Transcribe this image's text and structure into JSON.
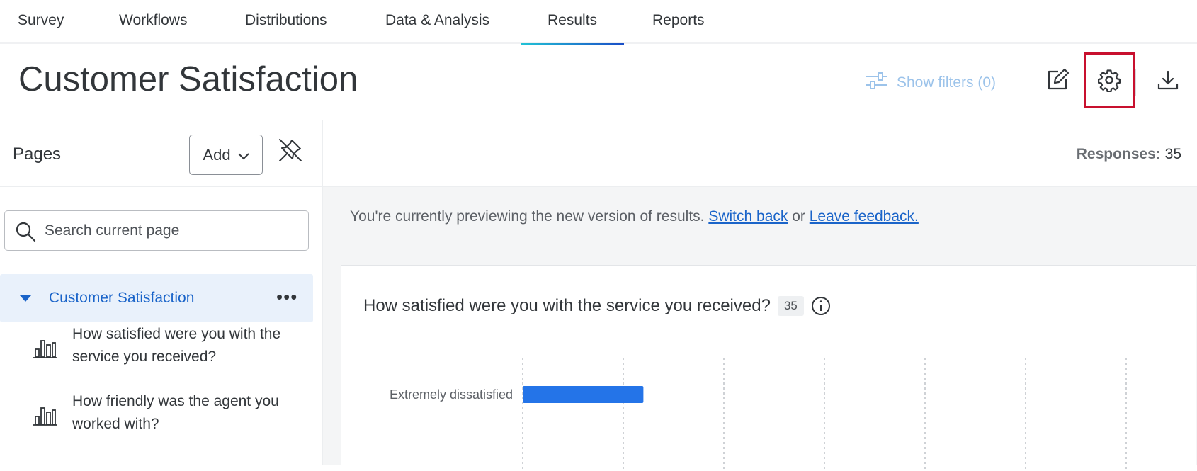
{
  "nav": {
    "tabs": [
      {
        "label": "Survey"
      },
      {
        "label": "Workflows"
      },
      {
        "label": "Distributions"
      },
      {
        "label": "Data & Analysis"
      },
      {
        "label": "Results"
      },
      {
        "label": "Reports"
      }
    ],
    "active": "Results"
  },
  "header": {
    "title": "Customer Satisfaction",
    "show_filters": "Show filters (0)"
  },
  "sidebar": {
    "pages_label": "Pages",
    "add_label": "Add",
    "search_placeholder": "Search current page",
    "page_item": {
      "label": "Customer Satisfaction",
      "more": "•••"
    },
    "questions": [
      {
        "label": "How satisfied were you with the service you received?"
      },
      {
        "label": "How friendly was the agent you worked with?"
      }
    ]
  },
  "main": {
    "responses_label": "Responses:",
    "responses_value": "35",
    "notice_text": "You're currently previewing the new version of results.",
    "switch_back": "Switch back",
    "or_text": "or",
    "leave_feedback": "Leave feedback.",
    "question_title": "How satisfied were you with the service you received?",
    "question_count": "35"
  },
  "chart_data": {
    "type": "bar",
    "orientation": "horizontal",
    "categories": [
      "Extremely dissatisfied"
    ],
    "values": [
      6
    ],
    "grid": true,
    "bar_color": "#2474e8"
  },
  "colors": {
    "accent": "#1a64c9",
    "highlight": "#c8102e"
  }
}
